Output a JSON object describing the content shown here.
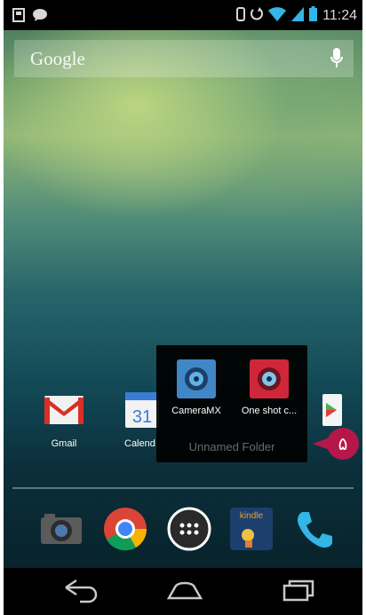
{
  "status_bar": {
    "time": "11:24",
    "left_icons": [
      "notification-icon",
      "chat-icon"
    ],
    "right_icons": [
      "vibrate-icon",
      "rotate-icon",
      "wifi-icon",
      "signal-icon",
      "battery-icon"
    ]
  },
  "search": {
    "label": "Google",
    "icon": "mic-icon"
  },
  "home_apps": [
    {
      "label": "Gmail",
      "icon": "gmail-icon"
    },
    {
      "label": "Calend",
      "icon": "calendar-icon",
      "calendar_day": "31"
    },
    {
      "label": "",
      "icon": "play-store-icon"
    }
  ],
  "folder": {
    "name": "Unnamed Folder",
    "apps": [
      {
        "label": "CameraMX",
        "icon": "cameramx-icon"
      },
      {
        "label": "One shot c...",
        "icon": "one-shot-camera-icon"
      }
    ]
  },
  "annotation": {
    "label": "۵",
    "color": "#b5174a"
  },
  "dock": [
    {
      "icon": "camera-icon"
    },
    {
      "icon": "chrome-icon"
    },
    {
      "icon": "app-drawer-icon"
    },
    {
      "icon": "kindle-icon",
      "label": "kindle"
    },
    {
      "icon": "phone-icon"
    }
  ],
  "nav_bar": [
    "back-icon",
    "home-icon",
    "recents-icon"
  ]
}
